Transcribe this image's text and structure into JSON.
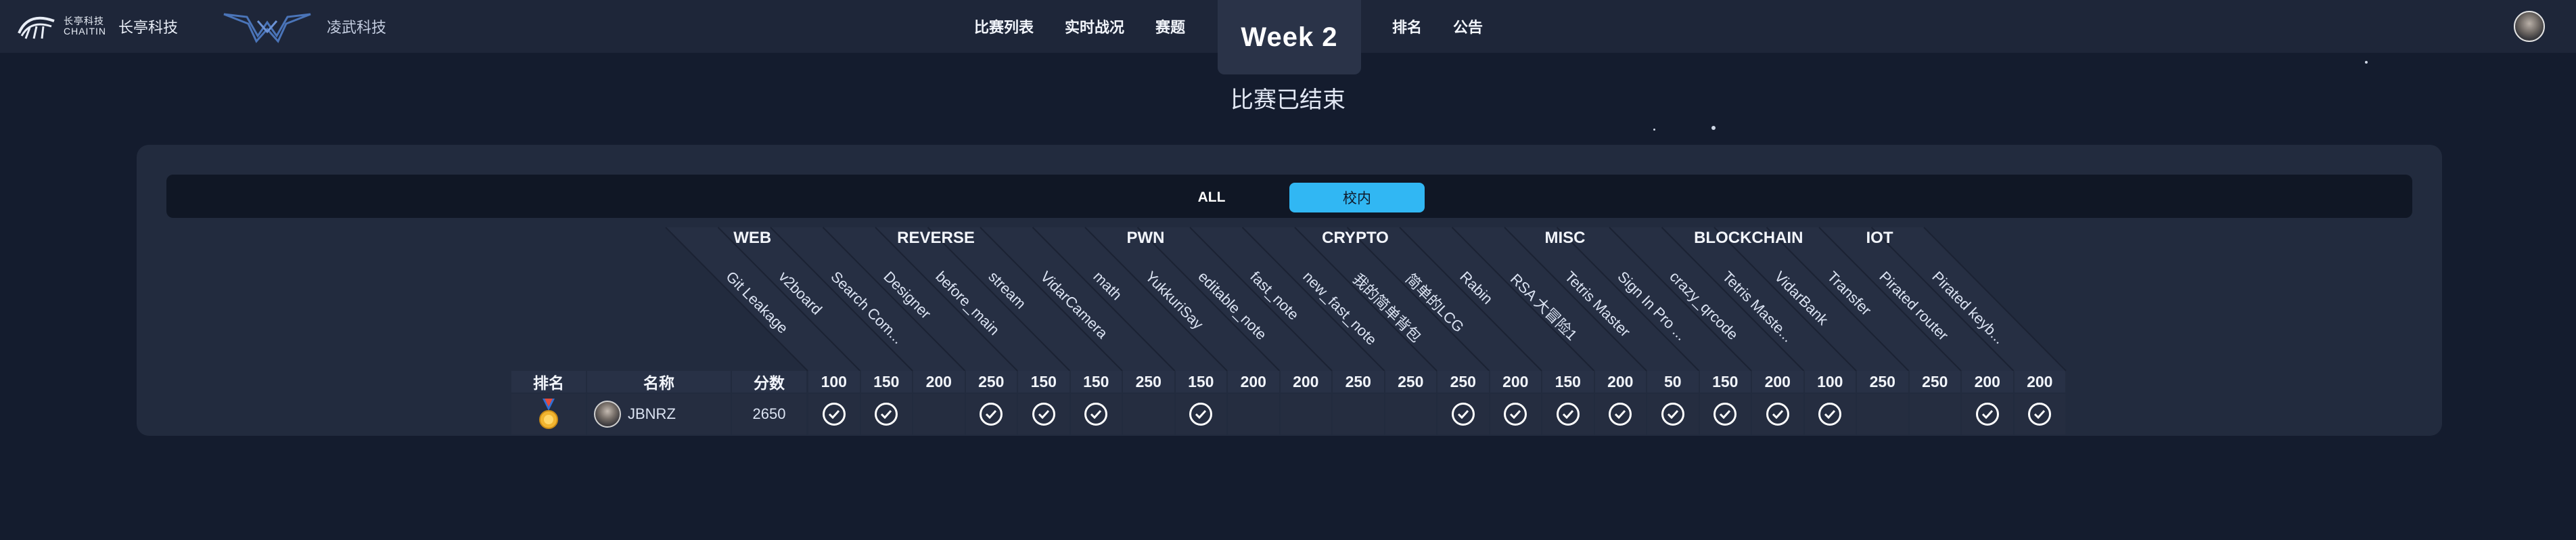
{
  "header": {
    "brand1_logo_line1": "长亭科技",
    "brand1_logo_line2": "CHAITIN",
    "brand1_name": "长亭科技",
    "brand2_name": "凌武科技",
    "week_label": "Week 2",
    "nav": {
      "list": "比赛列表",
      "live": "实时战况",
      "challenges": "赛题",
      "rank": "排名",
      "notice": "公告"
    }
  },
  "status_text": "比赛已结束",
  "tabs": {
    "all": "ALL",
    "school": "校内"
  },
  "categories": [
    "WEB",
    "REVERSE",
    "PWN",
    "CRYPTO",
    "MISC",
    "BLOCKCHAIN",
    "IOT"
  ],
  "challenges": [
    {
      "name": "Git Leakage",
      "score": "100"
    },
    {
      "name": "v2board",
      "score": "150"
    },
    {
      "name": "Search Com...",
      "score": "200"
    },
    {
      "name": "Designer",
      "score": "250"
    },
    {
      "name": "before_main",
      "score": "150"
    },
    {
      "name": "stream",
      "score": "150"
    },
    {
      "name": "VidarCamera",
      "score": "250"
    },
    {
      "name": "math",
      "score": "150"
    },
    {
      "name": "YukkuriSay",
      "score": "200"
    },
    {
      "name": "editable_note",
      "score": "200"
    },
    {
      "name": "fast_note",
      "score": "250"
    },
    {
      "name": "new_fast_note",
      "score": "250"
    },
    {
      "name": "我的简单背包",
      "score": "250"
    },
    {
      "name": "简单的LCG",
      "score": "200"
    },
    {
      "name": "Rabin",
      "score": "150"
    },
    {
      "name": "RSA 大冒险1",
      "score": "200"
    },
    {
      "name": "Tetris Master",
      "score": "50"
    },
    {
      "name": "Sign In Pro ...",
      "score": "150"
    },
    {
      "name": "crazy_qrcode",
      "score": "200"
    },
    {
      "name": "Tetris Maste...",
      "score": "100"
    },
    {
      "name": "VidarBank",
      "score": "250"
    },
    {
      "name": "Transfer",
      "score": "250"
    },
    {
      "name": "Pirated router",
      "score": "200"
    },
    {
      "name": "Pirated keyb...",
      "score": "200"
    }
  ],
  "table_headers": {
    "rank": "排名",
    "name": "名称",
    "score": "分数"
  },
  "rows": [
    {
      "rank_icon": "gold-medal-icon",
      "name": "JBNRZ",
      "score": "2650",
      "solved": [
        true,
        true,
        false,
        true,
        true,
        true,
        false,
        true,
        false,
        false,
        false,
        false,
        true,
        true,
        true,
        true,
        true,
        true,
        true,
        true,
        false,
        false,
        true,
        true
      ]
    }
  ],
  "colors": {
    "background": "#141c2e",
    "topbar": "#1e2639",
    "panel": "#222b3e",
    "accent": "#31b7f3"
  }
}
